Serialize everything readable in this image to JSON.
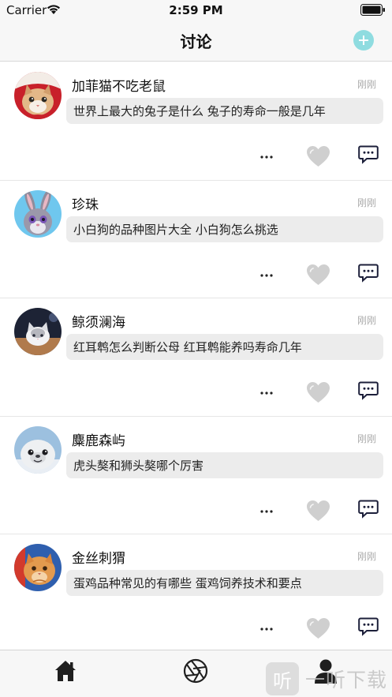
{
  "status": {
    "carrier": "Carrier",
    "time": "2:59 PM"
  },
  "nav": {
    "title": "讨论"
  },
  "posts": [
    {
      "username": "加菲猫不吃老鼠",
      "time": "刚刚",
      "content": "世界上最大的兔子是什么 兔子的寿命一般是几年"
    },
    {
      "username": "珍珠",
      "time": "刚刚",
      "content": "小白狗的品种图片大全 小白狗怎么挑选"
    },
    {
      "username": "鲸须澜海",
      "time": "刚刚",
      "content": "红耳鹎怎么判断公母 红耳鹎能养吗寿命几年"
    },
    {
      "username": "麋鹿森屿",
      "time": "刚刚",
      "content": "虎头獒和狮头獒哪个厉害"
    },
    {
      "username": "金丝刺猬",
      "time": "刚刚",
      "content": "蛋鸡品种常见的有哪些 蛋鸡饲养技术和要点"
    }
  ],
  "watermark": {
    "logo": "听",
    "text": "一听下载"
  },
  "colors": {
    "accent": "#8fdce0",
    "bubble": "#ececec",
    "comment_icon": "#1c1f3a",
    "like_icon": "#cfcfcf"
  }
}
